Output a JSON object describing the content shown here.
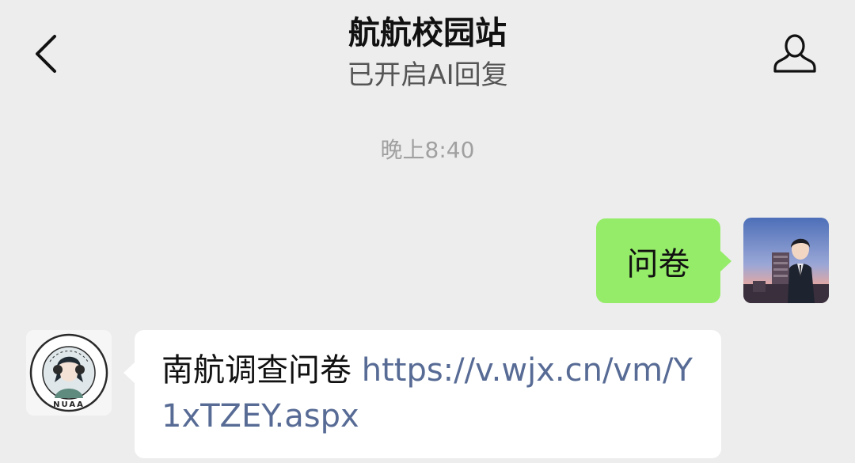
{
  "header": {
    "title": "航航校园站",
    "subtitle": "已开启AI回复",
    "back_icon": "chevron-left-icon",
    "profile_icon": "person-icon"
  },
  "chat": {
    "timestamp": "晚上8:40",
    "messages": [
      {
        "sender": "self",
        "text": "问卷",
        "bubble_color": "#95ec69"
      },
      {
        "sender": "bot",
        "text": "南航调查问卷",
        "link": "https://v.wjx.cn/vm/Y1xTZEY.aspx",
        "link_color": "#576b95"
      }
    ],
    "bot_avatar_text": "NUAA"
  },
  "colors": {
    "background": "#ededed",
    "self_bubble": "#95ec69",
    "bot_bubble": "#ffffff",
    "link": "#576b95"
  }
}
